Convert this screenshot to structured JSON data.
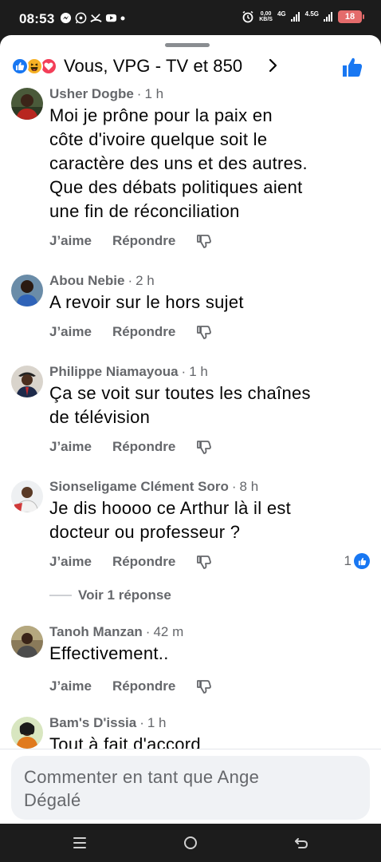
{
  "status_bar": {
    "time": "08:53",
    "icons_left": [
      "messenger-icon",
      "whatsapp-icon",
      "missed-call-icon",
      "youtube-icon",
      "dot-icon"
    ],
    "speed_top": "0,00",
    "speed_bottom": "KB/S",
    "network_1": "4G",
    "network_2": "4.5G",
    "battery": "18"
  },
  "header": {
    "title": "Vous, VPG - TV et 850",
    "reaction_icons": [
      "like-icon",
      "haha-icon",
      "love-icon"
    ]
  },
  "labels": {
    "like": "J’aime",
    "reply": "Répondre"
  },
  "comments": [
    {
      "name": "Usher Dogbe",
      "time": "1 h",
      "text_lines": [
        "Moi je prône pour la paix en",
        "côte d'ivoire quelque soit le",
        "caractère des uns et des autres.",
        "Que des débats politiques aient",
        "une fin de réconciliation"
      ]
    },
    {
      "name": "Abou Nebie",
      "time": "2 h",
      "text_lines": [
        "A revoir sur le hors sujet"
      ]
    },
    {
      "name": "Philippe Niamayoua",
      "time": "1 h",
      "text_lines": [
        "Ça se voit sur toutes les chaînes",
        "de télévision"
      ]
    },
    {
      "name": "Sionseligame Clément Soro",
      "time": "8 h",
      "text_lines": [
        "Je dis hoooo ce Arthur là il est",
        "docteur ou professeur ?"
      ],
      "reaction_count": "1",
      "replies_label": "Voir 1 réponse"
    },
    {
      "name": "Tanoh Manzan",
      "time": "42 m",
      "text_lines": [
        "Effectivement.."
      ]
    },
    {
      "name": "Bam's D'issia",
      "time": "1 h",
      "text_lines": [
        "Tout à fait d'accord"
      ]
    }
  ],
  "composer": {
    "placeholder_line1": "Commenter en tant que Ange",
    "placeholder_line2": "Dégalé"
  },
  "colors": {
    "facebook_blue": "#1877f2",
    "secondary_text": "#65676b",
    "primary_text": "#050505"
  }
}
